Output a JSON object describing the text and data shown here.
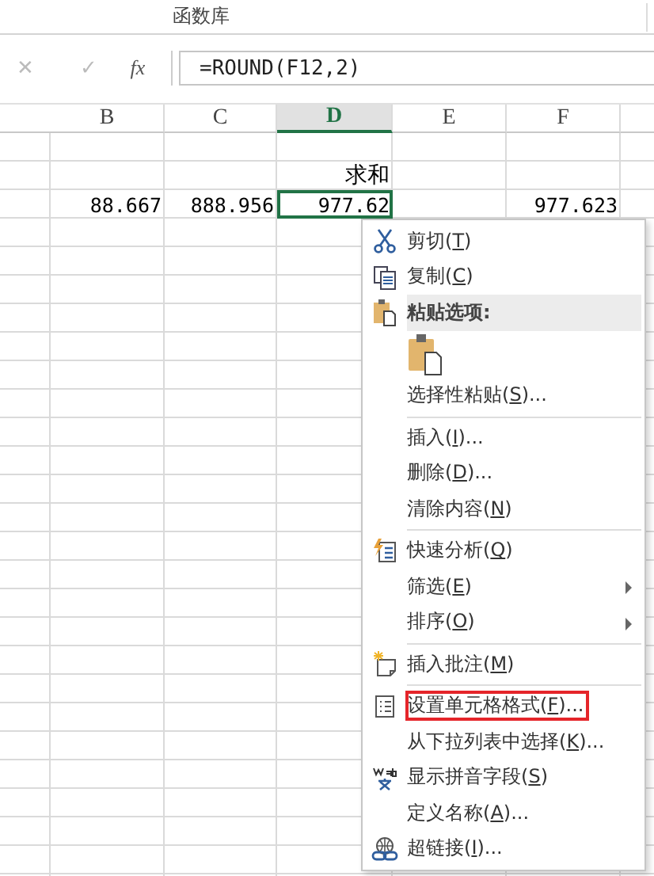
{
  "ribbon": {
    "group_label": "函数库"
  },
  "formula_bar": {
    "cancel": "✕",
    "enter": "✓",
    "function": "fx",
    "value": "=ROUND(F12,2)"
  },
  "sheet": {
    "columns": [
      {
        "label": "B",
        "selected": false
      },
      {
        "label": "C",
        "selected": false
      },
      {
        "label": "D",
        "selected": true
      },
      {
        "label": "E",
        "selected": false
      },
      {
        "label": "F",
        "selected": false
      }
    ],
    "rows": [
      {
        "cells": [
          "",
          "",
          "",
          "",
          ""
        ]
      },
      {
        "cells": [
          "",
          "",
          "求和",
          "",
          ""
        ]
      },
      {
        "cells": [
          "88.667",
          "888.956",
          "977.62",
          "",
          "977.623"
        ],
        "active": [
          false,
          false,
          true,
          false,
          false
        ]
      }
    ]
  },
  "context_menu": {
    "items": [
      {
        "kind": "item",
        "before": "剪切(",
        "key": "T",
        "after": ")"
      },
      {
        "kind": "item",
        "before": "复制(",
        "key": "C",
        "after": ")"
      },
      {
        "kind": "header",
        "before": "粘贴选项:"
      },
      {
        "kind": "paste_options"
      },
      {
        "kind": "item",
        "before": "选择性粘贴(",
        "key": "S",
        "after": ")..."
      },
      {
        "kind": "separator"
      },
      {
        "kind": "item",
        "before": "插入(",
        "key": "I",
        "after": ")..."
      },
      {
        "kind": "item",
        "before": "删除(",
        "key": "D",
        "after": ")..."
      },
      {
        "kind": "item",
        "before": "清除内容(",
        "key": "N",
        "after": ")"
      },
      {
        "kind": "separator"
      },
      {
        "kind": "item",
        "before": "快速分析(",
        "key": "Q",
        "after": ")"
      },
      {
        "kind": "item",
        "before": "筛选(",
        "key": "E",
        "after": ")",
        "submenu": true
      },
      {
        "kind": "item",
        "before": "排序(",
        "key": "O",
        "after": ")",
        "submenu": true
      },
      {
        "kind": "separator"
      },
      {
        "kind": "item",
        "before": "插入批注(",
        "key": "M",
        "after": ")"
      },
      {
        "kind": "separator"
      },
      {
        "kind": "item",
        "before": "设置单元格格式(",
        "key": "F",
        "after": ")...",
        "highlighted": true
      },
      {
        "kind": "item",
        "before": "从下拉列表中选择(",
        "key": "K",
        "after": ")..."
      },
      {
        "kind": "item",
        "before": "显示拼音字段(",
        "key": "S",
        "after": ")"
      },
      {
        "kind": "item",
        "before": "定义名称(",
        "key": "A",
        "after": ")..."
      },
      {
        "kind": "item",
        "before": "超链接(",
        "key": "I",
        "after": ")..."
      }
    ]
  }
}
